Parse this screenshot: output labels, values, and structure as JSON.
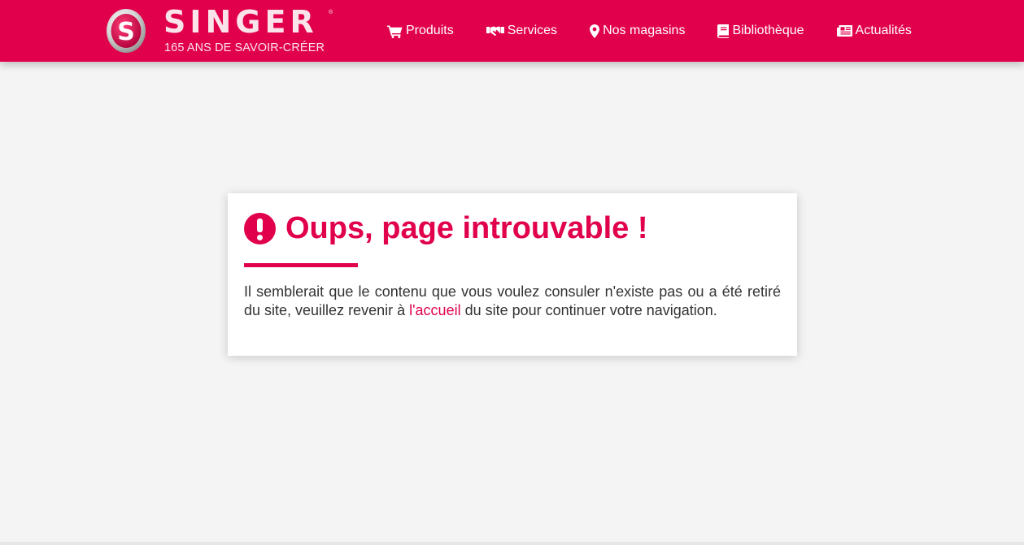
{
  "brand": {
    "name": "SINGER",
    "registered_mark": "®",
    "tagline": "165 ANS DE SAVOIR-CRÉER",
    "logo_letter": "S",
    "color": "#e1004c"
  },
  "nav": {
    "items": [
      {
        "label": "Produits",
        "icon": "cart-icon"
      },
      {
        "label": "Services",
        "icon": "handshake-icon"
      },
      {
        "label": "Nos magasins",
        "icon": "map-marker-icon"
      },
      {
        "label": "Bibliothèque",
        "icon": "book-icon"
      },
      {
        "label": "Actualités",
        "icon": "newspaper-icon"
      }
    ]
  },
  "error": {
    "icon": "exclamation-circle-icon",
    "title": "Oups, page introuvable !",
    "message_before": "Il semblerait que le contenu que vous voulez consuler n'existe pas ou a été retiré du site, veuillez revenir à ",
    "link_text": "l'accueil",
    "message_after": " du site pour continuer votre navigation."
  }
}
